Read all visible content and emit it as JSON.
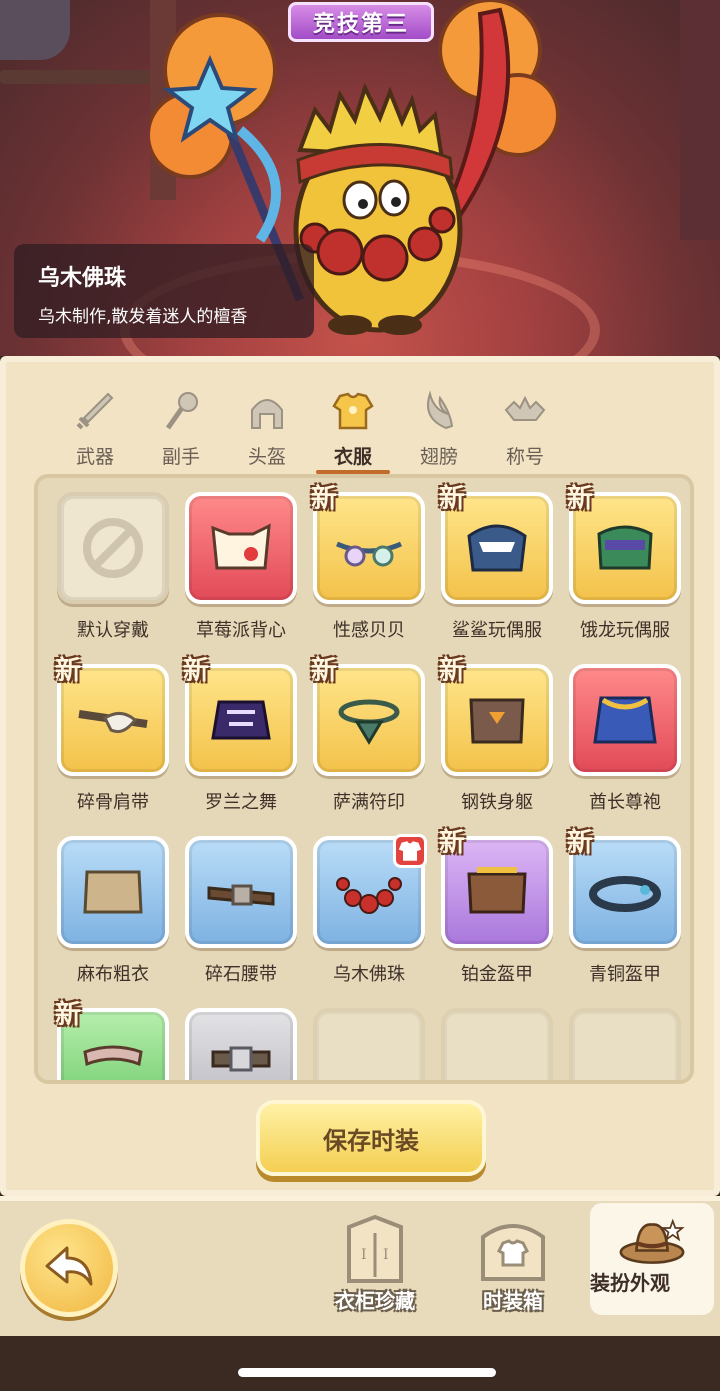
{
  "rank_banner": "竞技第三",
  "selected_item": {
    "name": "乌木佛珠",
    "description": "乌木制作,散发着迷人的檀香"
  },
  "tabs": [
    {
      "label": "武器",
      "icon": "sword-icon",
      "active": false
    },
    {
      "label": "副手",
      "icon": "offhand-icon",
      "active": false
    },
    {
      "label": "头盔",
      "icon": "helmet-icon",
      "active": false
    },
    {
      "label": "衣服",
      "icon": "armor-icon",
      "active": true
    },
    {
      "label": "翅膀",
      "icon": "wings-icon",
      "active": false
    },
    {
      "label": "称号",
      "icon": "title-icon",
      "active": false
    }
  ],
  "items": [
    {
      "name": "默认穿戴",
      "rarity": "default",
      "new": false
    },
    {
      "name": "草莓派背心",
      "rarity": "red",
      "new": false
    },
    {
      "name": "性感贝贝",
      "rarity": "gold",
      "new": true
    },
    {
      "name": "鲨鲨玩偶服",
      "rarity": "gold",
      "new": true
    },
    {
      "name": "饿龙玩偶服",
      "rarity": "gold",
      "new": true
    },
    {
      "name": "碎骨肩带",
      "rarity": "gold",
      "new": true
    },
    {
      "name": "罗兰之舞",
      "rarity": "gold",
      "new": true
    },
    {
      "name": "萨满符印",
      "rarity": "gold",
      "new": true
    },
    {
      "name": "钢铁身躯",
      "rarity": "gold",
      "new": true
    },
    {
      "name": "酋长尊袍",
      "rarity": "red",
      "new": false
    },
    {
      "name": "麻布粗衣",
      "rarity": "blue",
      "new": false
    },
    {
      "name": "碎石腰带",
      "rarity": "blue",
      "new": false
    },
    {
      "name": "乌木佛珠",
      "rarity": "blue",
      "new": false,
      "worn": true
    },
    {
      "name": "铂金盔甲",
      "rarity": "purple",
      "new": true
    },
    {
      "name": "青铜盔甲",
      "rarity": "blue",
      "new": true
    },
    {
      "name": "",
      "rarity": "green",
      "new": true
    },
    {
      "name": "",
      "rarity": "gray",
      "new": false
    },
    {
      "name": "",
      "rarity": "empty",
      "new": false
    },
    {
      "name": "",
      "rarity": "empty",
      "new": false
    },
    {
      "name": "",
      "rarity": "empty",
      "new": false
    }
  ],
  "new_badge_text": "新",
  "save_button": "保存时装",
  "bottom_nav": [
    {
      "label": "衣柜珍藏",
      "icon": "wardrobe-icon"
    },
    {
      "label": "时装箱",
      "icon": "fashion-box-icon"
    },
    {
      "label": "装扮外观",
      "icon": "cowboy-hat-icon",
      "active": true
    }
  ],
  "colors": {
    "accent": "#c26c2c",
    "panel": "#f1e3c4",
    "gold_tile": "#f3c24a",
    "red_tile": "#e24a58",
    "blue_tile": "#7eb2e2",
    "purple_tile": "#aa78dc",
    "green_tile": "#6cc86a"
  }
}
